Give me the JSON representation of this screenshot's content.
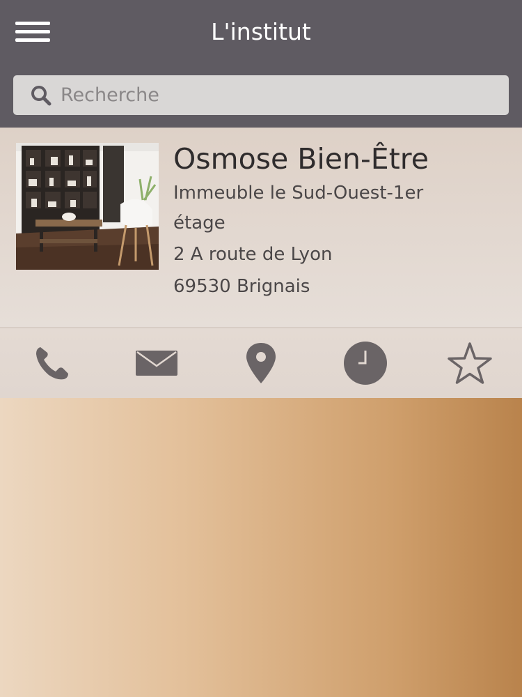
{
  "header": {
    "title": "L'institut",
    "menu_icon": "hamburger-menu-icon"
  },
  "search": {
    "placeholder": "Recherche",
    "value": "",
    "icon": "search-icon"
  },
  "business": {
    "name": "Osmose Bien-Être",
    "address_lines": [
      "Immeuble le Sud-Ouest-1er",
      "étage",
      "2 A route de Lyon",
      "69530 Brignais"
    ],
    "photo": "interior-photo"
  },
  "actions": [
    {
      "icon": "phone-icon"
    },
    {
      "icon": "mail-icon"
    },
    {
      "icon": "location-pin-icon"
    },
    {
      "icon": "clock-icon"
    },
    {
      "icon": "star-icon"
    }
  ],
  "colors": {
    "header_bg": "#5f5b62",
    "search_bg": "#d9d7d6",
    "icon_color": "#6a6466",
    "gradient_start": "#ecd7c0",
    "gradient_end": "#b9834c"
  }
}
